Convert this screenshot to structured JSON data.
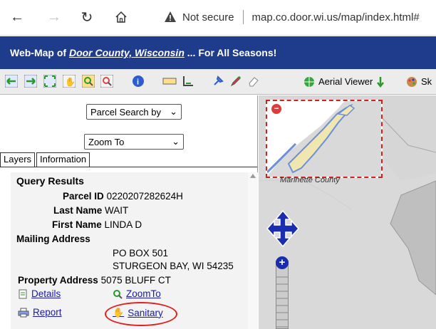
{
  "browser": {
    "back_icon": "arrow-left-icon",
    "forward_icon": "arrow-right-icon",
    "reload_icon": "reload-icon",
    "home_icon": "home-icon",
    "security_label": "Not secure",
    "url": "map.co.door.wi.us/map/index.html#"
  },
  "header": {
    "prefix": "Web-Map of ",
    "county_link": "Door County, Wisconsin",
    "suffix": " ... For All Seasons!",
    "background": "#1f3c8c"
  },
  "toolbar": {
    "aerial_viewer_label": "Aerial Viewer",
    "sk_label": "Sk"
  },
  "search": {
    "parcel_search_label": "Parcel Search by",
    "zoom_to_label": "Zoom To"
  },
  "tabs": [
    "Layers",
    "Information"
  ],
  "results": {
    "title": "Query Results",
    "parcel_id_label": "Parcel ID",
    "parcel_id": "0220207282624H",
    "last_name_label": "Last Name",
    "last_name": "WAIT",
    "first_name_label": "First Name",
    "first_name": "LINDA D",
    "mailing_address_label": "Mailing Address",
    "mailing_line1": "PO BOX 501",
    "mailing_line2": "STURGEON BAY, WI 54235",
    "property_address_label": "Property Address",
    "property_address": "5075 BLUFF CT",
    "links": {
      "details": "Details",
      "zoomto": "ZoomTo",
      "report": "Report",
      "sanitary": "Sanitary"
    }
  },
  "map": {
    "overview_label": "Marinette County"
  }
}
